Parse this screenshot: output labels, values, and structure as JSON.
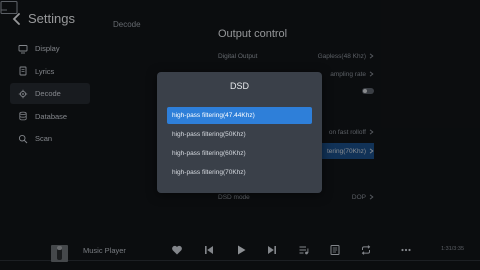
{
  "sidebar": {
    "title": "Settings",
    "items": [
      {
        "label": "Display",
        "icon": "monitor-icon"
      },
      {
        "label": "Lyrics",
        "icon": "document-icon"
      },
      {
        "label": "Decode",
        "icon": "gear-icon",
        "active": true
      },
      {
        "label": "Database",
        "icon": "database-icon"
      },
      {
        "label": "Scan",
        "icon": "search-icon"
      }
    ]
  },
  "section_label": "Decode",
  "panel": {
    "title": "Output control",
    "rows": [
      {
        "label": "Digital Output",
        "value": "Gapless(48 Khz)"
      },
      {
        "label": "",
        "value": "ampling rate"
      },
      {
        "label": "",
        "value": ""
      },
      {
        "label": "",
        "value": "on fast rolloff"
      },
      {
        "label": "",
        "value": "tering(70Khz)"
      },
      {
        "label": "DSD mode",
        "value": "DOP"
      }
    ]
  },
  "dialog": {
    "title": "DSD",
    "options": [
      {
        "label": "high-pass filtering(47.44Khz)",
        "selected": true
      },
      {
        "label": "high-pass filtering(50Khz)",
        "selected": false
      },
      {
        "label": "high-pass filtering(60Khz)",
        "selected": false
      },
      {
        "label": "high-pass filtering(70Khz)",
        "selected": false
      }
    ]
  },
  "player": {
    "title": "Music Player",
    "time": "1:31/3:35"
  },
  "colors": {
    "accent": "#2e7fd9",
    "background": "#121417",
    "dialog": "#3a4049"
  }
}
